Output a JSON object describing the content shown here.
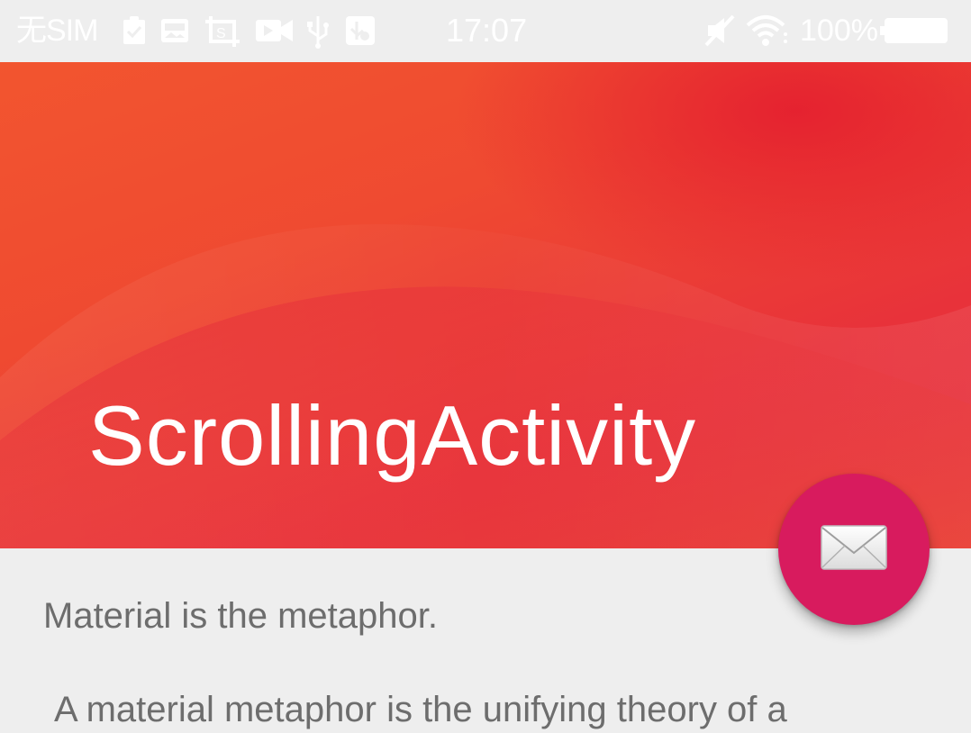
{
  "status_bar": {
    "carrier": "无SIM",
    "time": "17:07",
    "battery_percent": "100%",
    "icons": [
      "clipboard-check-icon",
      "gallery-icon",
      "screenshot-icon",
      "video-camera-icon",
      "usb-icon",
      "usb-debug-icon",
      "silent-icon",
      "wifi-icon",
      "battery-icon"
    ]
  },
  "app_bar": {
    "title": "ScrollingActivity"
  },
  "fab": {
    "icon": "mail-icon"
  },
  "content": {
    "line1": "Material is the metaphor.",
    "line2": "A material metaphor is the unifying theory of a"
  }
}
